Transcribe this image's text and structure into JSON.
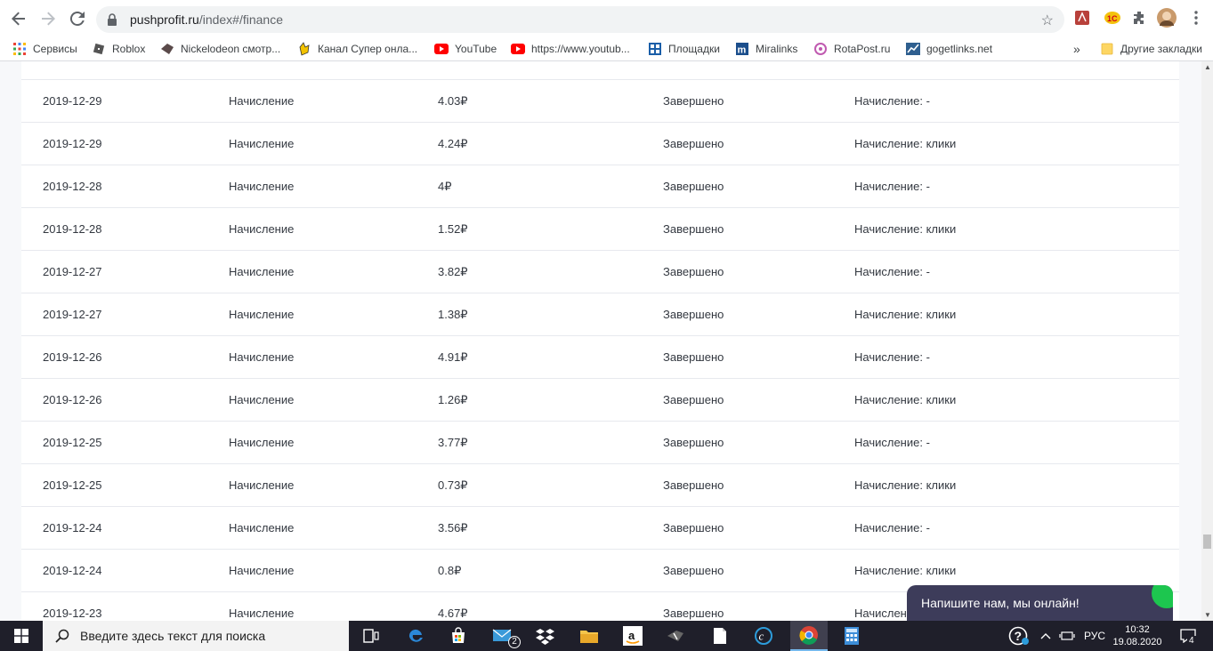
{
  "browser": {
    "url_host": "pushprofit.ru",
    "url_path": "/index#/finance"
  },
  "bookmarks": [
    {
      "label": "Сервисы",
      "icon": "apps-grid-icon"
    },
    {
      "label": "Roblox",
      "icon": "roblox-icon"
    },
    {
      "label": "Nickelodeon смотр...",
      "icon": "nickelodeon-icon"
    },
    {
      "label": "Канал Супер онла...",
      "icon": "super-channel-icon"
    },
    {
      "label": "YouTube",
      "icon": "youtube-icon"
    },
    {
      "label": "https://www.youtub...",
      "icon": "youtube-icon"
    },
    {
      "label": "Площадки",
      "icon": "sites-icon"
    },
    {
      "label": "Miralinks",
      "icon": "miralinks-icon"
    },
    {
      "label": "RotaPost.ru",
      "icon": "rotapost-icon"
    },
    {
      "label": "gogetlinks.net",
      "icon": "gogetlinks-icon"
    }
  ],
  "bookmarks_overflow": "»",
  "other_bookmarks": "Другие закладки",
  "rows": [
    {
      "date": "2019-12-29",
      "type": "Начисление",
      "amount": "4.03₽",
      "status": "Завершено",
      "desc": "Начисление: -"
    },
    {
      "date": "2019-12-29",
      "type": "Начисление",
      "amount": "4.24₽",
      "status": "Завершено",
      "desc": "Начисление: клики"
    },
    {
      "date": "2019-12-28",
      "type": "Начисление",
      "amount": "4₽",
      "status": "Завершено",
      "desc": "Начисление: -"
    },
    {
      "date": "2019-12-28",
      "type": "Начисление",
      "amount": "1.52₽",
      "status": "Завершено",
      "desc": "Начисление: клики"
    },
    {
      "date": "2019-12-27",
      "type": "Начисление",
      "amount": "3.82₽",
      "status": "Завершено",
      "desc": "Начисление: -"
    },
    {
      "date": "2019-12-27",
      "type": "Начисление",
      "amount": "1.38₽",
      "status": "Завершено",
      "desc": "Начисление: клики"
    },
    {
      "date": "2019-12-26",
      "type": "Начисление",
      "amount": "4.91₽",
      "status": "Завершено",
      "desc": "Начисление: -"
    },
    {
      "date": "2019-12-26",
      "type": "Начисление",
      "amount": "1.26₽",
      "status": "Завершено",
      "desc": "Начисление: клики"
    },
    {
      "date": "2019-12-25",
      "type": "Начисление",
      "amount": "3.77₽",
      "status": "Завершено",
      "desc": "Начисление: -"
    },
    {
      "date": "2019-12-25",
      "type": "Начисление",
      "amount": "0.73₽",
      "status": "Завершено",
      "desc": "Начисление: клики"
    },
    {
      "date": "2019-12-24",
      "type": "Начисление",
      "amount": "3.56₽",
      "status": "Завершено",
      "desc": "Начисление: -"
    },
    {
      "date": "2019-12-24",
      "type": "Начисление",
      "amount": "0.8₽",
      "status": "Завершено",
      "desc": "Начисление: клики"
    },
    {
      "date": "2019-12-23",
      "type": "Начисление",
      "amount": "4.67₽",
      "status": "Завершено",
      "desc": "Начислен"
    }
  ],
  "chat": {
    "label": "Напишите нам, мы онлайн!"
  },
  "taskbar": {
    "search_placeholder": "Введите здесь текст для поиска",
    "mail_badge": "2",
    "language": "РУС",
    "time": "10:32",
    "date": "19.08.2020",
    "notifications": "4"
  },
  "colors": {
    "accent_green": "#1dc64f",
    "chat_bg": "#3d3c5a",
    "taskbar_bg": "#1f1f2a"
  }
}
